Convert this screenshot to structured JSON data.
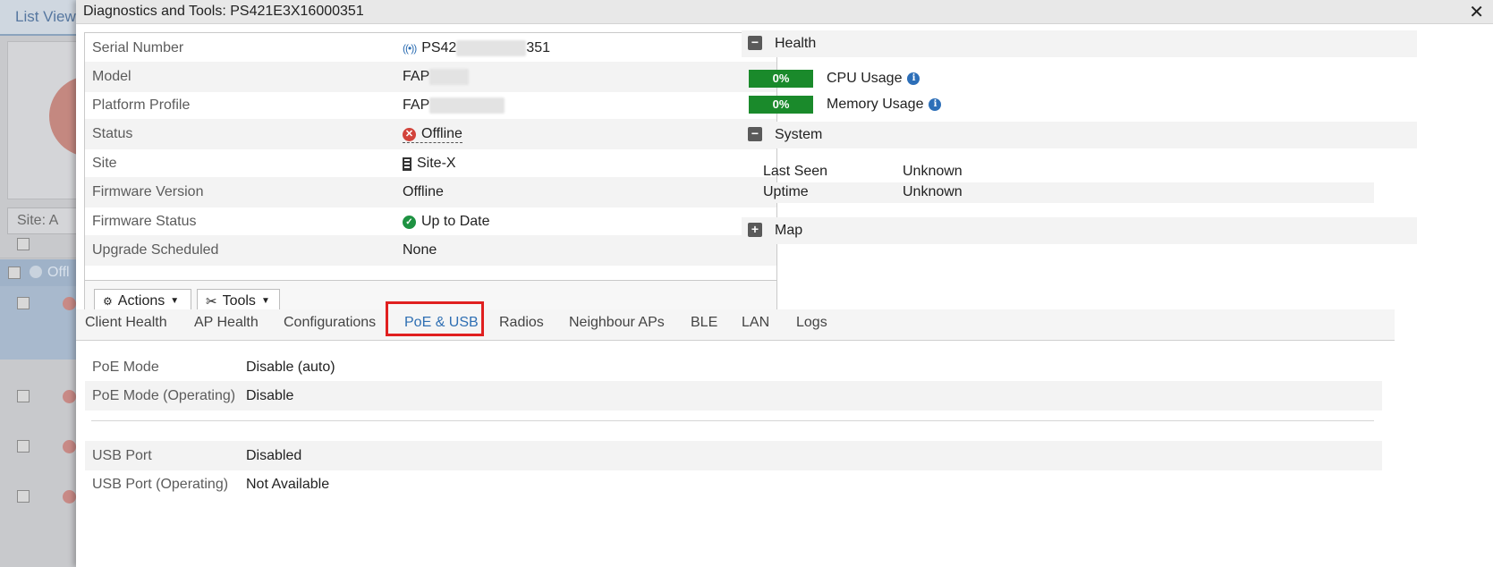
{
  "background": {
    "tab_label": "List View",
    "filter_label": "Site: A",
    "selected_row_label": "Offl"
  },
  "dialog": {
    "title": "Diagnostics and Tools: PS421E3X16000351",
    "close_glyph": "✕"
  },
  "info": {
    "rows": [
      {
        "label": "Serial Number",
        "prefix": "PS42",
        "suffix": "351"
      },
      {
        "label": "Model",
        "prefix": "FAP"
      },
      {
        "label": "Platform Profile",
        "prefix": "FAP"
      },
      {
        "label": "Status",
        "value": "Offline"
      },
      {
        "label": "Site",
        "value": "Site-X"
      },
      {
        "label": "Firmware Version",
        "value": "Offline"
      },
      {
        "label": "Firmware Status",
        "value": "Up to Date"
      },
      {
        "label": "Upgrade Scheduled",
        "value": "None"
      }
    ],
    "actions_label": "Actions",
    "tools_label": "Tools"
  },
  "health": {
    "title": "Health",
    "cpu_value": "0%",
    "cpu_label": "CPU Usage",
    "memory_value": "0%",
    "memory_label": "Memory Usage"
  },
  "system": {
    "title": "System",
    "last_seen_label": "Last Seen",
    "last_seen_value": "Unknown",
    "uptime_label": "Uptime",
    "uptime_value": "Unknown"
  },
  "map": {
    "title": "Map"
  },
  "tabs": [
    "Client Health",
    "AP Health",
    "Configurations",
    "PoE & USB",
    "Radios",
    "Neighbour APs",
    "BLE",
    "LAN",
    "Logs"
  ],
  "active_tab": "PoE & USB",
  "poe_usb": {
    "poe_mode_label": "PoE Mode",
    "poe_mode_value": "Disable (auto)",
    "poe_mode_op_label": "PoE Mode (Operating)",
    "poe_mode_op_value": "Disable",
    "usb_port_label": "USB Port",
    "usb_port_value": "Disabled",
    "usb_port_op_label": "USB Port (Operating)",
    "usb_port_op_value": "Not Available"
  },
  "colors": {
    "accent": "#2f6fb3",
    "usage_bar": "#1a8a2b",
    "offline": "#d2433b",
    "ok": "#1e9242",
    "highlight": "#e02020"
  }
}
